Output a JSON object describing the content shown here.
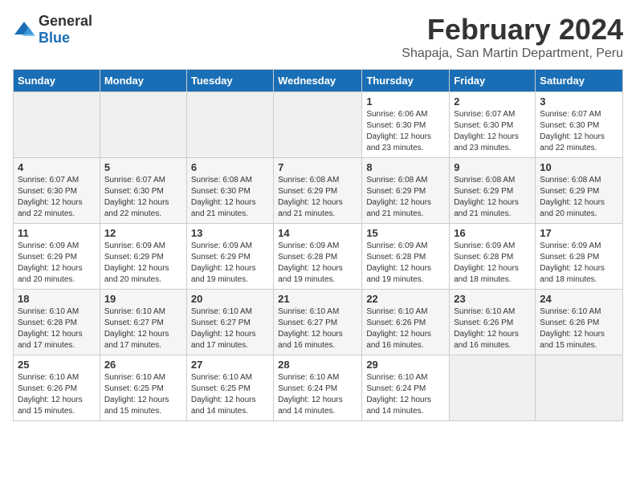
{
  "logo": {
    "general": "General",
    "blue": "Blue"
  },
  "header": {
    "month": "February 2024",
    "location": "Shapaja, San Martin Department, Peru"
  },
  "weekdays": [
    "Sunday",
    "Monday",
    "Tuesday",
    "Wednesday",
    "Thursday",
    "Friday",
    "Saturday"
  ],
  "weeks": [
    [
      {
        "day": "",
        "sunrise": "",
        "sunset": "",
        "daylight": ""
      },
      {
        "day": "",
        "sunrise": "",
        "sunset": "",
        "daylight": ""
      },
      {
        "day": "",
        "sunrise": "",
        "sunset": "",
        "daylight": ""
      },
      {
        "day": "",
        "sunrise": "",
        "sunset": "",
        "daylight": ""
      },
      {
        "day": "1",
        "sunrise": "Sunrise: 6:06 AM",
        "sunset": "Sunset: 6:30 PM",
        "daylight": "Daylight: 12 hours and 23 minutes."
      },
      {
        "day": "2",
        "sunrise": "Sunrise: 6:07 AM",
        "sunset": "Sunset: 6:30 PM",
        "daylight": "Daylight: 12 hours and 23 minutes."
      },
      {
        "day": "3",
        "sunrise": "Sunrise: 6:07 AM",
        "sunset": "Sunset: 6:30 PM",
        "daylight": "Daylight: 12 hours and 22 minutes."
      }
    ],
    [
      {
        "day": "4",
        "sunrise": "Sunrise: 6:07 AM",
        "sunset": "Sunset: 6:30 PM",
        "daylight": "Daylight: 12 hours and 22 minutes."
      },
      {
        "day": "5",
        "sunrise": "Sunrise: 6:07 AM",
        "sunset": "Sunset: 6:30 PM",
        "daylight": "Daylight: 12 hours and 22 minutes."
      },
      {
        "day": "6",
        "sunrise": "Sunrise: 6:08 AM",
        "sunset": "Sunset: 6:30 PM",
        "daylight": "Daylight: 12 hours and 21 minutes."
      },
      {
        "day": "7",
        "sunrise": "Sunrise: 6:08 AM",
        "sunset": "Sunset: 6:29 PM",
        "daylight": "Daylight: 12 hours and 21 minutes."
      },
      {
        "day": "8",
        "sunrise": "Sunrise: 6:08 AM",
        "sunset": "Sunset: 6:29 PM",
        "daylight": "Daylight: 12 hours and 21 minutes."
      },
      {
        "day": "9",
        "sunrise": "Sunrise: 6:08 AM",
        "sunset": "Sunset: 6:29 PM",
        "daylight": "Daylight: 12 hours and 21 minutes."
      },
      {
        "day": "10",
        "sunrise": "Sunrise: 6:08 AM",
        "sunset": "Sunset: 6:29 PM",
        "daylight": "Daylight: 12 hours and 20 minutes."
      }
    ],
    [
      {
        "day": "11",
        "sunrise": "Sunrise: 6:09 AM",
        "sunset": "Sunset: 6:29 PM",
        "daylight": "Daylight: 12 hours and 20 minutes."
      },
      {
        "day": "12",
        "sunrise": "Sunrise: 6:09 AM",
        "sunset": "Sunset: 6:29 PM",
        "daylight": "Daylight: 12 hours and 20 minutes."
      },
      {
        "day": "13",
        "sunrise": "Sunrise: 6:09 AM",
        "sunset": "Sunset: 6:29 PM",
        "daylight": "Daylight: 12 hours and 19 minutes."
      },
      {
        "day": "14",
        "sunrise": "Sunrise: 6:09 AM",
        "sunset": "Sunset: 6:28 PM",
        "daylight": "Daylight: 12 hours and 19 minutes."
      },
      {
        "day": "15",
        "sunrise": "Sunrise: 6:09 AM",
        "sunset": "Sunset: 6:28 PM",
        "daylight": "Daylight: 12 hours and 19 minutes."
      },
      {
        "day": "16",
        "sunrise": "Sunrise: 6:09 AM",
        "sunset": "Sunset: 6:28 PM",
        "daylight": "Daylight: 12 hours and 18 minutes."
      },
      {
        "day": "17",
        "sunrise": "Sunrise: 6:09 AM",
        "sunset": "Sunset: 6:28 PM",
        "daylight": "Daylight: 12 hours and 18 minutes."
      }
    ],
    [
      {
        "day": "18",
        "sunrise": "Sunrise: 6:10 AM",
        "sunset": "Sunset: 6:28 PM",
        "daylight": "Daylight: 12 hours and 17 minutes."
      },
      {
        "day": "19",
        "sunrise": "Sunrise: 6:10 AM",
        "sunset": "Sunset: 6:27 PM",
        "daylight": "Daylight: 12 hours and 17 minutes."
      },
      {
        "day": "20",
        "sunrise": "Sunrise: 6:10 AM",
        "sunset": "Sunset: 6:27 PM",
        "daylight": "Daylight: 12 hours and 17 minutes."
      },
      {
        "day": "21",
        "sunrise": "Sunrise: 6:10 AM",
        "sunset": "Sunset: 6:27 PM",
        "daylight": "Daylight: 12 hours and 16 minutes."
      },
      {
        "day": "22",
        "sunrise": "Sunrise: 6:10 AM",
        "sunset": "Sunset: 6:26 PM",
        "daylight": "Daylight: 12 hours and 16 minutes."
      },
      {
        "day": "23",
        "sunrise": "Sunrise: 6:10 AM",
        "sunset": "Sunset: 6:26 PM",
        "daylight": "Daylight: 12 hours and 16 minutes."
      },
      {
        "day": "24",
        "sunrise": "Sunrise: 6:10 AM",
        "sunset": "Sunset: 6:26 PM",
        "daylight": "Daylight: 12 hours and 15 minutes."
      }
    ],
    [
      {
        "day": "25",
        "sunrise": "Sunrise: 6:10 AM",
        "sunset": "Sunset: 6:26 PM",
        "daylight": "Daylight: 12 hours and 15 minutes."
      },
      {
        "day": "26",
        "sunrise": "Sunrise: 6:10 AM",
        "sunset": "Sunset: 6:25 PM",
        "daylight": "Daylight: 12 hours and 15 minutes."
      },
      {
        "day": "27",
        "sunrise": "Sunrise: 6:10 AM",
        "sunset": "Sunset: 6:25 PM",
        "daylight": "Daylight: 12 hours and 14 minutes."
      },
      {
        "day": "28",
        "sunrise": "Sunrise: 6:10 AM",
        "sunset": "Sunset: 6:24 PM",
        "daylight": "Daylight: 12 hours and 14 minutes."
      },
      {
        "day": "29",
        "sunrise": "Sunrise: 6:10 AM",
        "sunset": "Sunset: 6:24 PM",
        "daylight": "Daylight: 12 hours and 14 minutes."
      },
      {
        "day": "",
        "sunrise": "",
        "sunset": "",
        "daylight": ""
      },
      {
        "day": "",
        "sunrise": "",
        "sunset": "",
        "daylight": ""
      }
    ]
  ]
}
